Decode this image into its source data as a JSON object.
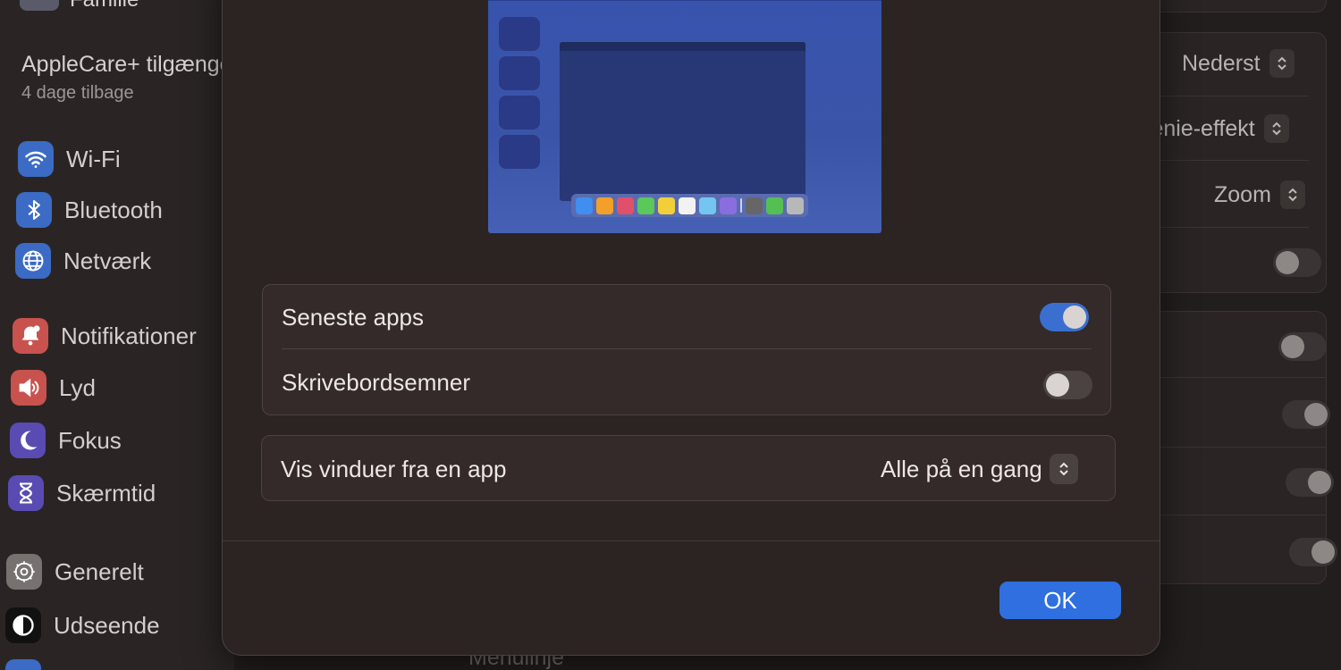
{
  "sidebar": {
    "family_label": "Familie",
    "applecare_title": "AppleCare+ tilgængelig",
    "applecare_sub": "4 dage tilbage",
    "items": [
      {
        "label": "Wi-Fi",
        "icon": "wifi-icon"
      },
      {
        "label": "Bluetooth",
        "icon": "bluetooth-icon"
      },
      {
        "label": "Netværk",
        "icon": "globe-icon"
      },
      {
        "label": "Notifikationer",
        "icon": "bell-icon"
      },
      {
        "label": "Lyd",
        "icon": "speaker-icon"
      },
      {
        "label": "Fokus",
        "icon": "moon-icon"
      },
      {
        "label": "Skærmtid",
        "icon": "hourglass-icon"
      },
      {
        "label": "Generelt",
        "icon": "gear-icon"
      },
      {
        "label": "Udseende",
        "icon": "appearance-icon"
      }
    ]
  },
  "background": {
    "select_1": "Nederst",
    "select_2": "Genie-effekt",
    "select_3": "Zoom",
    "menulinje": "Menulinje"
  },
  "modal": {
    "group1": {
      "row1_label": "Seneste apps",
      "row1_on": true,
      "row2_label": "Skrivebordsemner",
      "row2_on": false
    },
    "group2": {
      "row_label": "Vis vinduer fra en app",
      "select_value": "Alle på en gang"
    },
    "ok_label": "OK"
  },
  "colors": {
    "accent": "#2f6fe0",
    "toggle_on": "#3a6fd0",
    "dock_icons": [
      "#3f8ef0",
      "#f2a02a",
      "#e0506a",
      "#5ac85a",
      "#f2cf3a",
      "#f2f2f2",
      "#74c6f0",
      "#8a6ee0",
      "#666666",
      "#54c054",
      "#b8b8b8"
    ]
  }
}
